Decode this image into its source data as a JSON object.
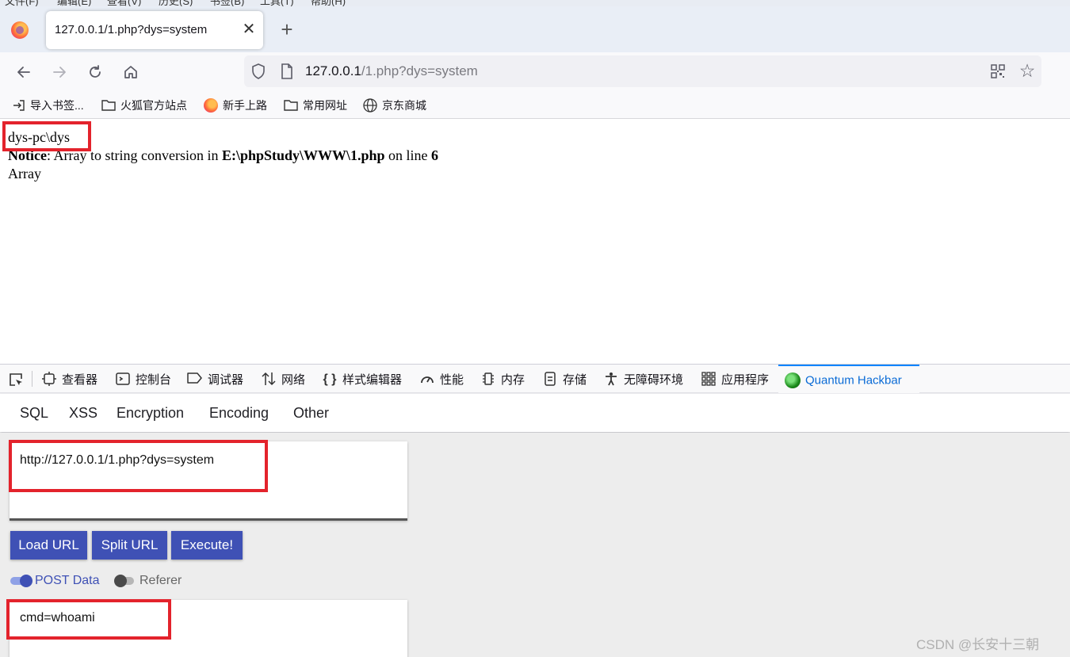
{
  "menu": {
    "items": [
      "文件(F)",
      "编辑(E)",
      "查看(V)",
      "历史(S)",
      "书签(B)",
      "工具(T)",
      "帮助(H)"
    ]
  },
  "tabs": [
    {
      "title": "127.0.0.1/1.php?dys=system",
      "close": "✕"
    }
  ],
  "new_tab": "+",
  "url": {
    "host": "127.0.0.1",
    "path": "/1.php?dys=system"
  },
  "bookmarks": [
    {
      "label": "导入书签...",
      "icon": "import-icon"
    },
    {
      "label": "火狐官方站点",
      "icon": "folder-icon"
    },
    {
      "label": "新手上路",
      "icon": "firefox-icon"
    },
    {
      "label": "常用网址",
      "icon": "folder-icon"
    },
    {
      "label": "京东商城",
      "icon": "globe-icon"
    }
  ],
  "page": {
    "line1": "dys-pc\\dys",
    "notice_label": "Notice",
    "notice_text1": ": Array to string conversion in ",
    "notice_file": "E:\\phpStudy\\WWW\\1.php",
    "notice_text2": " on line ",
    "notice_line": "6",
    "line3": "Array"
  },
  "devtools": {
    "tabs": [
      {
        "label": "查看器",
        "icon": "inspector-icon"
      },
      {
        "label": "控制台",
        "icon": "console-icon"
      },
      {
        "label": "调试器",
        "icon": "debugger-icon"
      },
      {
        "label": "网络",
        "icon": "network-icon"
      },
      {
        "label": "样式编辑器",
        "icon": "style-editor-icon"
      },
      {
        "label": "性能",
        "icon": "performance-icon"
      },
      {
        "label": "内存",
        "icon": "memory-icon"
      },
      {
        "label": "存储",
        "icon": "storage-icon"
      },
      {
        "label": "无障碍环境",
        "icon": "accessibility-icon"
      },
      {
        "label": "应用程序",
        "icon": "application-icon"
      },
      {
        "label": "Quantum Hackbar",
        "icon": "hackbar-icon"
      }
    ],
    "active_tab": "Quantum Hackbar",
    "accent": "#0a84ff"
  },
  "hackbar": {
    "menu": [
      "SQL",
      "XSS",
      "Encryption",
      "Encoding",
      "Other"
    ],
    "url_value": "http://127.0.0.1/1.php?dys=system",
    "buttons": [
      "Load URL",
      "Split URL",
      "Execute!"
    ],
    "button_color": "#3f51b5",
    "toggles": [
      {
        "label": "POST Data",
        "on": true
      },
      {
        "label": "Referer",
        "on": false
      }
    ],
    "post_value": "cmd=whoami"
  },
  "watermark": "CSDN @长安十三朝",
  "highlight_color": "#e3232c"
}
